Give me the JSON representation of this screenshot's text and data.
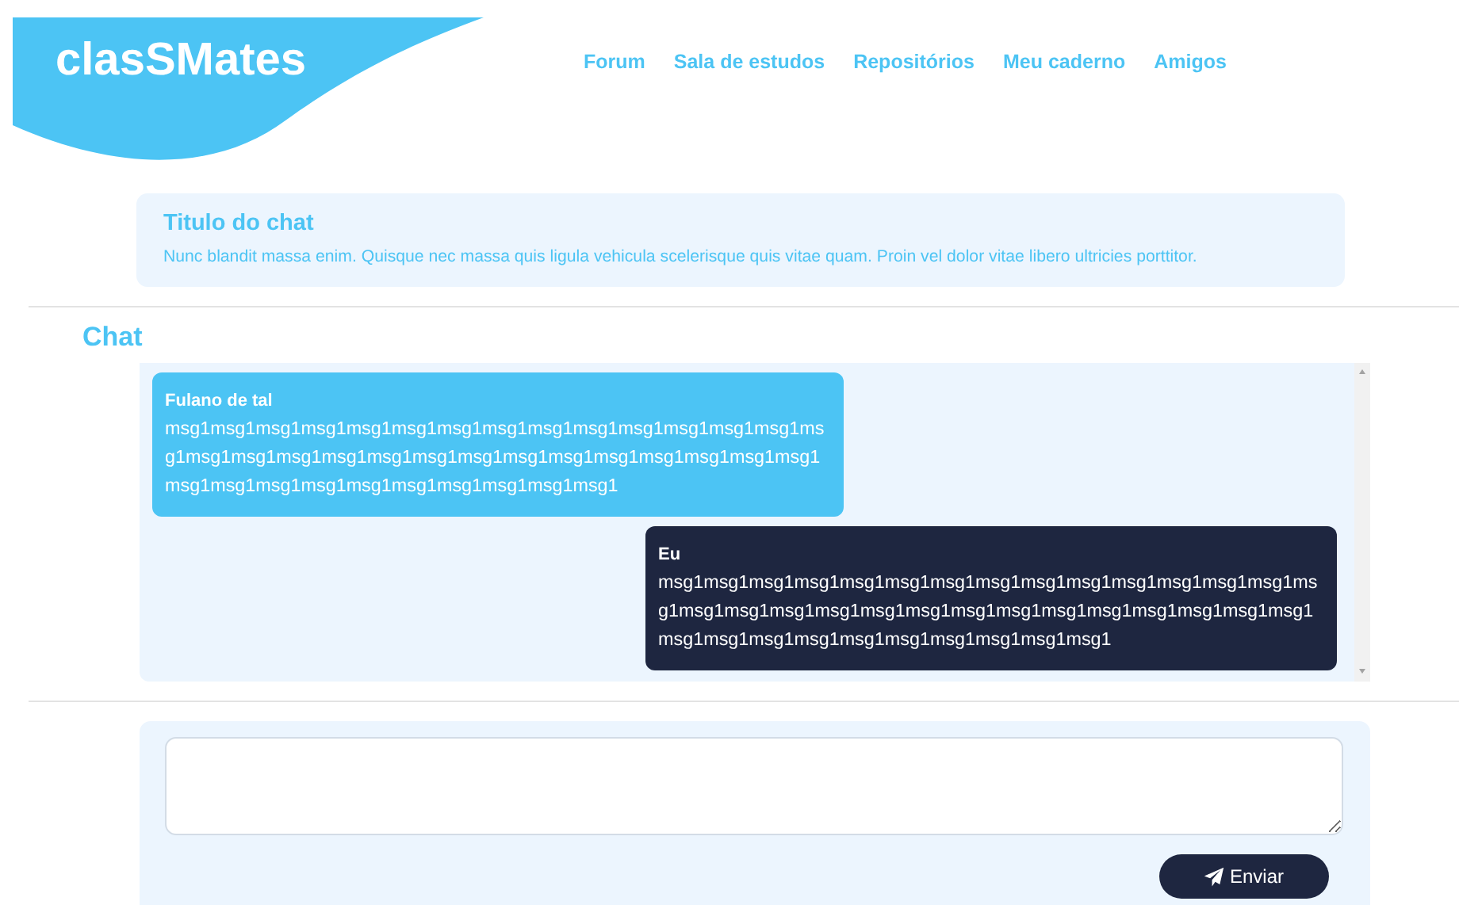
{
  "brand": "clasSMates",
  "nav": [
    "Forum",
    "Sala de estudos",
    "Repositórios",
    "Meu caderno",
    "Amigos"
  ],
  "chat_info": {
    "title": "Titulo do chat",
    "description": "Nunc blandit massa enim. Quisque nec massa quis ligula vehicula scelerisque quis vitae quam. Proin vel dolor vitae libero ultricies porttitor."
  },
  "section_title": "Chat",
  "messages": [
    {
      "kind": "other",
      "author": "Fulano de tal",
      "text": "msg1msg1msg1msg1msg1msg1msg1msg1msg1msg1msg1msg1msg1msg1msg1msg1msg1msg1msg1msg1msg1msg1msg1msg1msg1msg1msg1msg1msg1msg1msg1msg1msg1msg1msg1msg1msg1msg1msg1"
    },
    {
      "kind": "own",
      "author": "Eu",
      "text": "msg1msg1msg1msg1msg1msg1msg1msg1msg1msg1msg1msg1msg1msg1msg1msg1msg1msg1msg1msg1msg1msg1msg1msg1msg1msg1msg1msg1msg1msg1msg1msg1msg1msg1msg1msg1msg1msg1msg1"
    }
  ],
  "send_button": "Enviar"
}
